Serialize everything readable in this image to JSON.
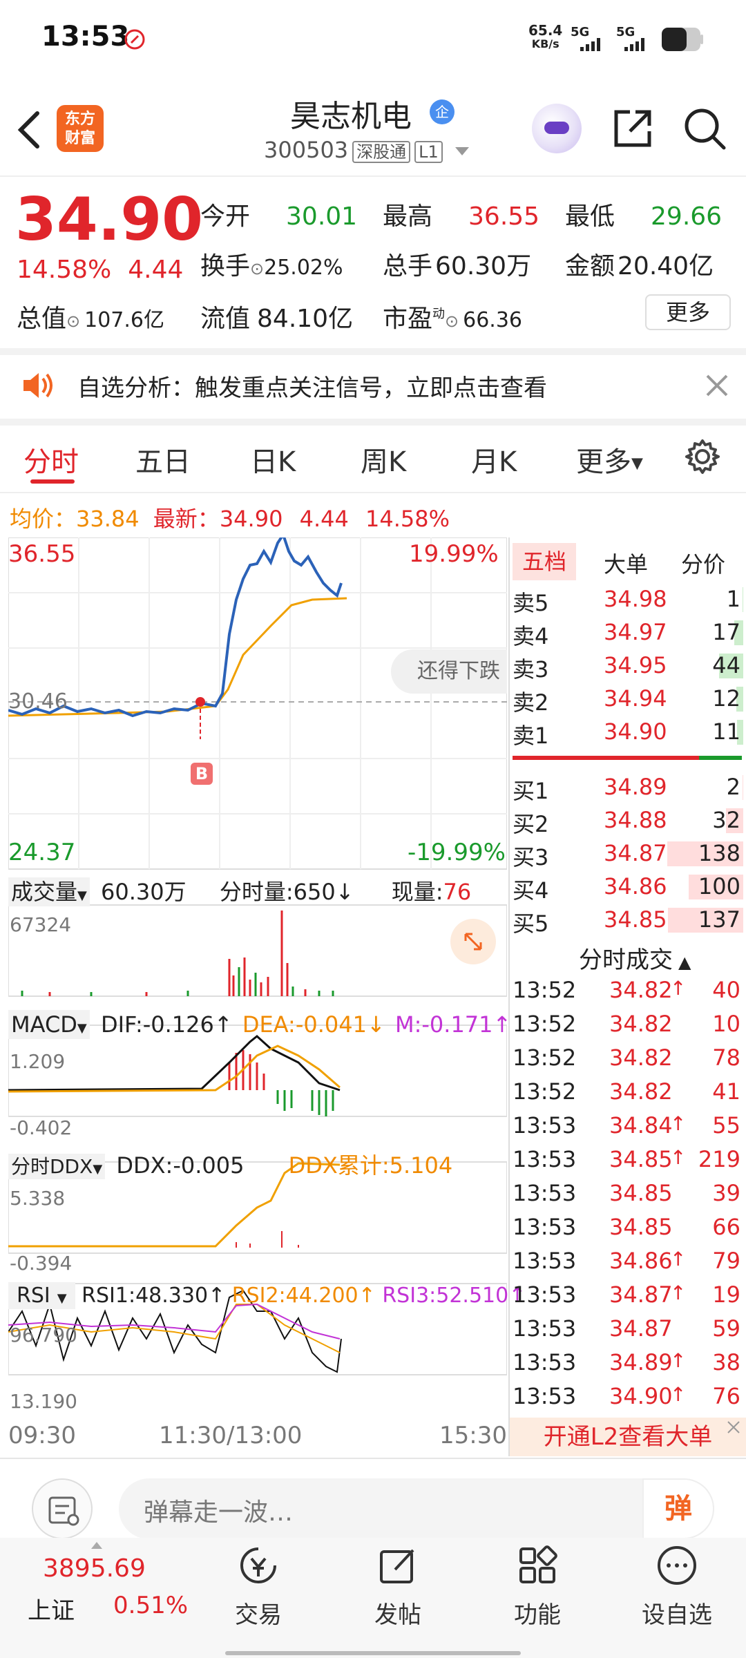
{
  "status": {
    "time": "13:53",
    "net_speed": "65.4",
    "net_unit": "KB/s",
    "sig1": "5G",
    "sig2": "5G"
  },
  "header": {
    "logo": "东方\n财富",
    "stock_name": "昊志机电",
    "qi_badge": "企",
    "code": "300503",
    "tag1": "深股通",
    "tag2": "L1"
  },
  "quote": {
    "price": "34.90",
    "change_pct": "14.58%",
    "change": "4.44",
    "open_label": "今开",
    "open": "30.01",
    "high_label": "最高",
    "high": "36.55",
    "low_label": "最低",
    "low": "29.66",
    "turnover_label": "换手",
    "turnover": "25.02%",
    "volume_label": "总手",
    "volume": "60.30万",
    "amount_label": "金额",
    "amount": "20.40亿",
    "mcap_label": "总值",
    "mcap": "107.6亿",
    "float_label": "流值",
    "float": "84.10亿",
    "pe_label": "市盈",
    "pe_sup": "动",
    "pe": "66.36",
    "more": "更多"
  },
  "notice": {
    "text": "自选分析：触发重点关注信号，立即点击查看"
  },
  "tabs": [
    "分时",
    "五日",
    "日K",
    "周K",
    "月K",
    "更多"
  ],
  "avgline": {
    "avg_label": "均价：",
    "avg": "33.84",
    "latest_label": "最新：",
    "latest": "34.90",
    "chg": "4.44",
    "pct": "14.58%"
  },
  "chart": {
    "ymax": "36.55",
    "ymin": "24.37",
    "pmax": "19.99%",
    "pmin": "-19.99%",
    "ref": "30.46",
    "b_marker": "B",
    "toast": "还得下跌",
    "time_start": "09:30",
    "time_mid": "11:30/13:00",
    "time_end": "15:30"
  },
  "volume": {
    "label": "成交量",
    "total": "60.30万",
    "fen_label": "分时量:",
    "fen": "650",
    "xian_label": "现量:",
    "xian": "76",
    "max": "67324"
  },
  "macd": {
    "label": "MACD",
    "dif": "DIF:-0.126",
    "dea": "DEA:-0.041",
    "m": "M:-0.171",
    "top": "1.209",
    "bottom": "-0.402"
  },
  "ddx": {
    "label": "分时DDX",
    "ddx": "DDX:-0.005",
    "sum": "DDX累计:5.104",
    "top": "5.338",
    "bottom": "-0.394"
  },
  "rsi": {
    "label": "RSI",
    "r1": "RSI1:48.330",
    "r2": "RSI2:44.200",
    "r3": "RSI3:52.510",
    "top": "96.790",
    "bottom": "13.190"
  },
  "side_tabs": [
    "五档",
    "大单",
    "分价"
  ],
  "sell": [
    {
      "label": "卖5",
      "price": "34.98",
      "vol": "1",
      "bar": 0.01
    },
    {
      "label": "卖4",
      "price": "34.97",
      "vol": "17",
      "bar": 0.12
    },
    {
      "label": "卖3",
      "price": "34.95",
      "vol": "44",
      "bar": 0.32
    },
    {
      "label": "卖2",
      "price": "34.94",
      "vol": "12",
      "bar": 0.09
    },
    {
      "label": "卖1",
      "price": "34.90",
      "vol": "11",
      "bar": 0.08
    }
  ],
  "buy": [
    {
      "label": "买1",
      "price": "34.89",
      "vol": "2",
      "bar": 0.01
    },
    {
      "label": "买2",
      "price": "34.88",
      "vol": "32",
      "bar": 0.23
    },
    {
      "label": "买3",
      "price": "34.87",
      "vol": "138",
      "bar": 1.0
    },
    {
      "label": "买4",
      "price": "34.86",
      "vol": "100",
      "bar": 0.72
    },
    {
      "label": "买5",
      "price": "34.85",
      "vol": "137",
      "bar": 0.99
    }
  ],
  "ticks_title": "分时成交",
  "ticks": [
    {
      "t": "13:52",
      "p": "34.82",
      "up": true,
      "v": "40"
    },
    {
      "t": "13:52",
      "p": "34.82",
      "up": false,
      "v": "10"
    },
    {
      "t": "13:52",
      "p": "34.82",
      "up": false,
      "v": "78"
    },
    {
      "t": "13:52",
      "p": "34.82",
      "up": false,
      "v": "41"
    },
    {
      "t": "13:53",
      "p": "34.84",
      "up": true,
      "v": "55"
    },
    {
      "t": "13:53",
      "p": "34.85",
      "up": true,
      "v": "219"
    },
    {
      "t": "13:53",
      "p": "34.85",
      "up": false,
      "v": "39"
    },
    {
      "t": "13:53",
      "p": "34.85",
      "up": false,
      "v": "66"
    },
    {
      "t": "13:53",
      "p": "34.86",
      "up": true,
      "v": "79"
    },
    {
      "t": "13:53",
      "p": "34.87",
      "up": true,
      "v": "19"
    },
    {
      "t": "13:53",
      "p": "34.87",
      "up": false,
      "v": "59"
    },
    {
      "t": "13:53",
      "p": "34.89",
      "up": true,
      "v": "38"
    },
    {
      "t": "13:53",
      "p": "34.90",
      "up": true,
      "v": "76"
    }
  ],
  "l2_banner": "开通L2查看大单",
  "comment": {
    "placeholder": "弹幕走一波…",
    "dan": "弹"
  },
  "bottom": {
    "index_value": "3895.69",
    "index_name": "上证",
    "index_pct": "0.51%",
    "items": [
      "交易",
      "发帖",
      "功能",
      "设自选"
    ]
  }
}
